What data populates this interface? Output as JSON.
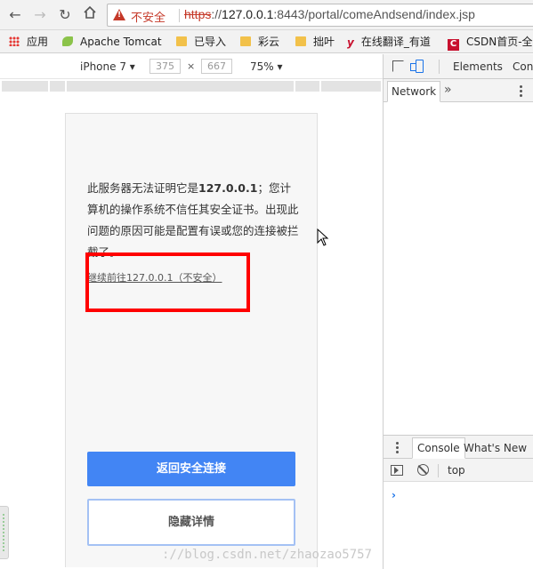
{
  "browser": {
    "omnibox": {
      "security_label": "不安全",
      "url_scheme": "https",
      "url_host": "127.0.0.1",
      "url_rest": ":8443/portal/comeAndsend/index.jsp"
    },
    "bookmarks": [
      {
        "label": "应用",
        "icon": "apps-grid-icon"
      },
      {
        "label": "Apache Tomcat",
        "icon": "tomcat-icon"
      },
      {
        "label": "已导入",
        "icon": "folder-icon"
      },
      {
        "label": "彩云",
        "icon": "folder-icon"
      },
      {
        "label": "拙叶",
        "icon": "folder-icon"
      },
      {
        "label": "在线翻译_有道",
        "icon": "youdao-icon"
      },
      {
        "label": "CSDN首页-全",
        "icon": "csdn-icon"
      }
    ]
  },
  "device_toolbar": {
    "device": "iPhone 7",
    "width": "375",
    "x_sign": "×",
    "height": "667",
    "zoom": "75%"
  },
  "page": {
    "message_prefix": "此服务器无法证明它是",
    "message_host": "127.0.0.1",
    "message_suffix": "；您计算机的操作系统不信任其安全证书。出现此问题的原因可能是配置有误或您的连接被拦截了。",
    "proceed_link": "继续前往127.0.0.1（不安全）",
    "back_button": "返回安全连接",
    "details_button": "隐藏详情"
  },
  "devtools": {
    "tabs": [
      "Elements",
      "Cons"
    ],
    "network_tab": "Network",
    "more_tabs": "»",
    "drawer_tabs": {
      "console": "Console",
      "whats_new": "What's New"
    },
    "context": "top",
    "prompt": "›"
  },
  "watermark": "://blog.csdn.net/zhaozao5757",
  "colors": {
    "insecure_red": "#c53929",
    "primary_blue": "#4285f4",
    "highlight_red": "#ff0000"
  }
}
